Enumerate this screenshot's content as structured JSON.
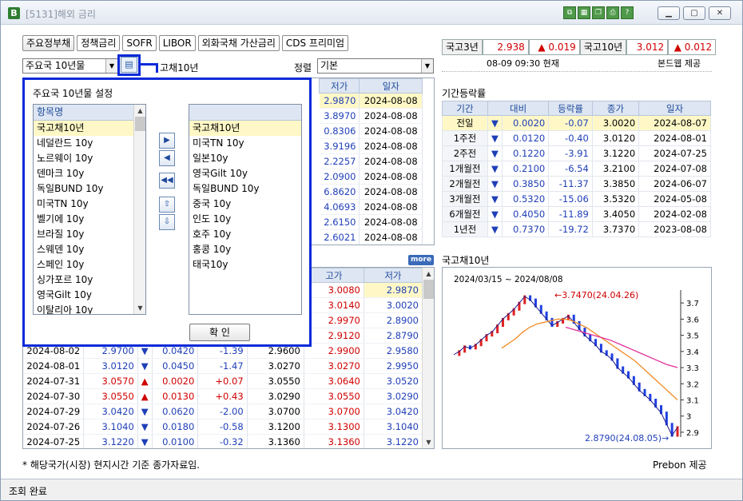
{
  "window": {
    "title": "[5131]해외 금리"
  },
  "tabs": [
    "주요정부채",
    "정책금리",
    "SOFR",
    "LIBOR",
    "외화국채 가산금리",
    "CDS 프리미엄"
  ],
  "controls": {
    "country_group": "주요국 10년물",
    "selected_label": "고채10년",
    "sort_label": "정렬",
    "sort_value": "기본"
  },
  "quote": {
    "items": [
      {
        "label": "국고3년",
        "value": "2.938",
        "change": "▲ 0.019"
      },
      {
        "label": "국고10년",
        "value": "3.012",
        "change": "▲ 0.012"
      }
    ],
    "time": "08-09 09:30 현재",
    "source": "본드웹 제공"
  },
  "main_grid": {
    "headers": [
      "저가",
      "일자"
    ],
    "rows": [
      [
        "2.9870",
        "2024-08-08"
      ],
      [
        "3.8970",
        "2024-08-08"
      ],
      [
        "0.8306",
        "2024-08-08"
      ],
      [
        "3.9196",
        "2024-08-08"
      ],
      [
        "2.2257",
        "2024-08-08"
      ],
      [
        "2.0900",
        "2024-08-08"
      ],
      [
        "6.8620",
        "2024-08-08"
      ],
      [
        "4.0693",
        "2024-08-08"
      ],
      [
        "2.6150",
        "2024-08-08"
      ],
      [
        "2.6021",
        "2024-08-08"
      ]
    ]
  },
  "period": {
    "title": "기간등락률",
    "headers": [
      "기간",
      "대비",
      "등락률",
      "종가",
      "일자"
    ],
    "rows": [
      [
        "전일",
        "▼",
        "0.0020",
        "-0.07",
        "3.0020",
        "2024-08-07"
      ],
      [
        "1주전",
        "▼",
        "0.0120",
        "-0.40",
        "3.0120",
        "2024-08-01"
      ],
      [
        "2주전",
        "▼",
        "0.1220",
        "-3.91",
        "3.1220",
        "2024-07-25"
      ],
      [
        "1개월전",
        "▼",
        "0.2100",
        "-6.54",
        "3.2100",
        "2024-07-08"
      ],
      [
        "2개월전",
        "▼",
        "0.3850",
        "-11.37",
        "3.3850",
        "2024-06-07"
      ],
      [
        "3개월전",
        "▼",
        "0.5320",
        "-15.06",
        "3.5320",
        "2024-05-08"
      ],
      [
        "6개월전",
        "▼",
        "0.4050",
        "-11.89",
        "3.4050",
        "2024-02-08"
      ],
      [
        "1년전",
        "▼",
        "0.7370",
        "-19.72",
        "3.7370",
        "2023-08-08"
      ]
    ]
  },
  "history": {
    "more_label": "more",
    "headers": [
      "고가",
      "저가"
    ],
    "rows": [
      [
        "",
        "",
        "",
        "",
        "",
        "",
        "3.0080",
        "2.9870"
      ],
      [
        "",
        "",
        "",
        "",
        "",
        "",
        "3.0140",
        "3.0020"
      ],
      [
        "",
        "",
        "",
        "",
        "",
        "",
        "2.9970",
        "2.8900"
      ],
      [
        "",
        "",
        "",
        "",
        "",
        "",
        "2.9120",
        "2.8790"
      ],
      [
        "2024-08-02",
        "2.9700",
        "▼",
        "0.0420",
        "-1.39",
        "2.9600",
        "2.9900",
        "2.9580"
      ],
      [
        "2024-08-01",
        "3.0120",
        "▼",
        "0.0450",
        "-1.47",
        "3.0270",
        "3.0270",
        "2.9950"
      ],
      [
        "2024-07-31",
        "3.0570",
        "▲",
        "0.0020",
        "+0.07",
        "3.0550",
        "3.0640",
        "3.0520"
      ],
      [
        "2024-07-30",
        "3.0550",
        "▲",
        "0.0130",
        "+0.43",
        "3.0290",
        "3.0550",
        "3.0290"
      ],
      [
        "2024-07-29",
        "3.0420",
        "▼",
        "0.0620",
        "-2.00",
        "3.0700",
        "3.0700",
        "3.0420"
      ],
      [
        "2024-07-26",
        "3.1040",
        "▼",
        "0.0180",
        "-0.58",
        "3.1200",
        "3.1300",
        "3.1040"
      ],
      [
        "2024-07-25",
        "3.1220",
        "▼",
        "0.0100",
        "-0.32",
        "3.1360",
        "3.1360",
        "3.1220"
      ]
    ]
  },
  "chart": {
    "title": "국고채10년",
    "period": "2024/03/15 ~ 2024/08/08",
    "high_label": "3.7470(24.04.26)",
    "low_label": "2.8790(24.08.05)",
    "y_ticks": [
      "3.7",
      "3.6",
      "3.5",
      "3.4",
      "3.3",
      "3.2",
      "3.1",
      "3",
      "2.9"
    ]
  },
  "chart_data": {
    "type": "line",
    "title": "국고채10년",
    "y_range": [
      2.87,
      3.78
    ],
    "y_ticks": [
      3.7,
      3.6,
      3.5,
      3.4,
      3.3,
      3.2,
      3.1,
      3.0,
      2.9
    ],
    "series": [
      {
        "values": [
          3.38,
          3.4,
          3.43,
          3.42,
          3.44,
          3.47,
          3.5,
          3.52,
          3.56,
          3.6,
          3.63,
          3.66,
          3.7,
          3.74,
          3.72,
          3.68,
          3.64,
          3.6,
          3.56,
          3.58,
          3.6,
          3.62,
          3.58,
          3.54,
          3.5,
          3.47,
          3.44,
          3.4,
          3.38,
          3.35,
          3.3,
          3.27,
          3.24,
          3.2,
          3.16,
          3.13,
          3.1,
          3.06,
          3.02,
          2.95,
          2.88,
          2.93
        ]
      },
      {
        "values": [
          3.42,
          3.45,
          3.48,
          3.52,
          3.55,
          3.57,
          3.58,
          3.59,
          3.6,
          3.6,
          3.59,
          3.57,
          3.55,
          3.52,
          3.49,
          3.46,
          3.43,
          3.4,
          3.37,
          3.34,
          3.3,
          3.26,
          3.22,
          3.18,
          3.14,
          3.1
        ]
      },
      {
        "values": [
          3.55,
          3.53,
          3.51,
          3.49,
          3.47,
          3.44,
          3.41,
          3.38,
          3.35,
          3.32,
          3.3
        ]
      }
    ]
  },
  "popup": {
    "title": "주요국 10년물 설정",
    "left_header": "항목명",
    "left_items": [
      "국고채10년",
      "네덜란드 10y",
      "노르웨이 10y",
      "덴마크 10y",
      "독일BUND 10y",
      "미국TN 10y",
      "벨기에 10y",
      "브라질 10y",
      "스웨덴 10y",
      "스페인 10y",
      "싱가포르 10y",
      "영국Gilt 10y",
      "이탈리아 10y"
    ],
    "right_header": "",
    "right_items": [
      "국고채10년",
      "미국TN 10y",
      "일본10y",
      "영국Gilt 10y",
      "독일BUND 10y",
      "중국 10y",
      "인도 10y",
      "호주 10y",
      "홍콩 10y",
      "태국10y"
    ],
    "confirm_label": "확 인"
  },
  "footnote": "* 해당국가(시장) 현지시간 기준 종가자료임.",
  "chart_source": "Prebon 제공",
  "status": "조회 완료"
}
